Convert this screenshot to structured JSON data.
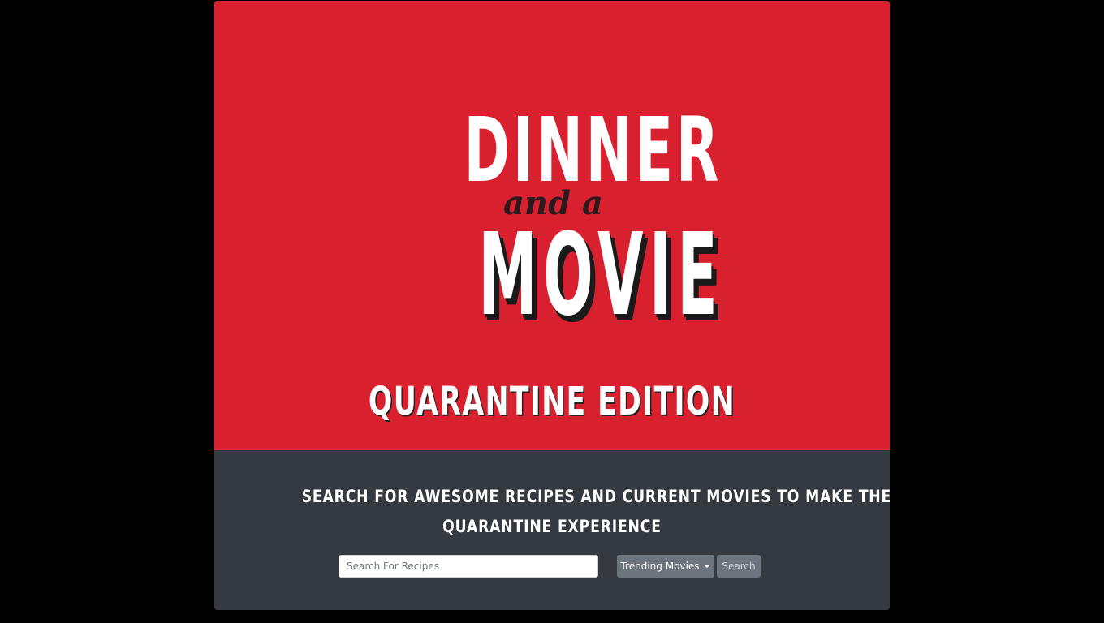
{
  "logo": {
    "line1": "DINNER",
    "line2": "and a",
    "line3": "MOVIE"
  },
  "hero": {
    "subtitle": "QUARANTINE EDITION"
  },
  "tagline": {
    "line1": "SEARCH FOR AWESOME RECIPES AND CURRENT MOVIES TO MAKE THE MOST OF YOUR",
    "line2": "QUARANTINE EXPERIENCE"
  },
  "search": {
    "placeholder": "Search For Recipes",
    "value": ""
  },
  "buttons": {
    "trending_label": "Trending Movies",
    "search_label": "Search"
  },
  "colors": {
    "page_background": "#000000",
    "hero_background": "#d9202f",
    "panel_background": "#343a40",
    "button_background": "#6c757d"
  }
}
